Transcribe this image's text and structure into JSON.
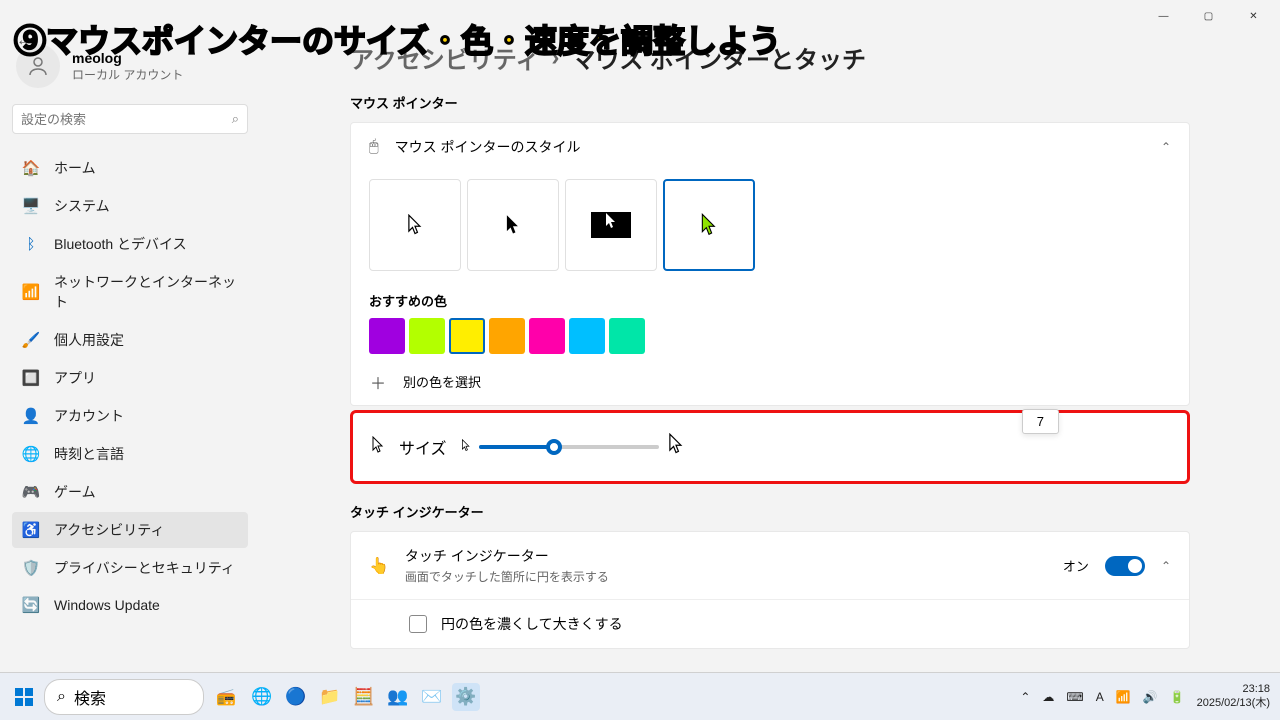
{
  "overlay_title": "⑨マウスポインターのサイズ・色・速度を調整しよう",
  "window": {
    "minimize": "—",
    "maximize": "▢",
    "close": "✕"
  },
  "user": {
    "name": "meolog",
    "sub": "ローカル アカウント"
  },
  "search": {
    "placeholder": "設定の検索"
  },
  "nav": {
    "items": [
      {
        "icon": "🏠",
        "label": "ホーム"
      },
      {
        "icon": "🖥️",
        "label": "システム"
      },
      {
        "icon": "ᛒ",
        "label": "Bluetooth とデバイス",
        "color": "#0067c0"
      },
      {
        "icon": "📶",
        "label": "ネットワークとインターネット",
        "color": "#0aa"
      },
      {
        "icon": "🖌️",
        "label": "個人用設定"
      },
      {
        "icon": "🔲",
        "label": "アプリ",
        "color": "#e07"
      },
      {
        "icon": "👤",
        "label": "アカウント",
        "color": "#09c"
      },
      {
        "icon": "🌐",
        "label": "時刻と言語"
      },
      {
        "icon": "🎮",
        "label": "ゲーム"
      },
      {
        "icon": "♿",
        "label": "アクセシビリティ",
        "color": "#0067c0",
        "active": true
      },
      {
        "icon": "🛡️",
        "label": "プライバシーとセキュリティ"
      },
      {
        "icon": "🔄",
        "label": "Windows Update",
        "color": "#09c"
      }
    ]
  },
  "breadcrumb": {
    "parent": "アクセシビリティ",
    "sep": "›",
    "current": "マウス ポインターとタッチ"
  },
  "sections": {
    "pointer_label": "マウス ポインター",
    "style_title": "マウス ポインターのスタイル",
    "rec_color_label": "おすすめの色",
    "colors": [
      "#a000e0",
      "#b3ff00",
      "#ffee00",
      "#ffa500",
      "#ff00aa",
      "#00bfff",
      "#00e6a8"
    ],
    "selected_color_idx": 2,
    "more_color": "別の色を選択",
    "size_label": "サイズ",
    "size_value": "7",
    "touch_label": "タッチ インジケーター",
    "touch_title": "タッチ インジケーター",
    "touch_sub": "画面でタッチした箇所に円を表示する",
    "touch_toggle_label": "オン",
    "touch_option": "円の色を濃くして大きくする"
  },
  "taskbar": {
    "search": "検索",
    "time": "23:18",
    "date": "2025/02/13(木)"
  }
}
